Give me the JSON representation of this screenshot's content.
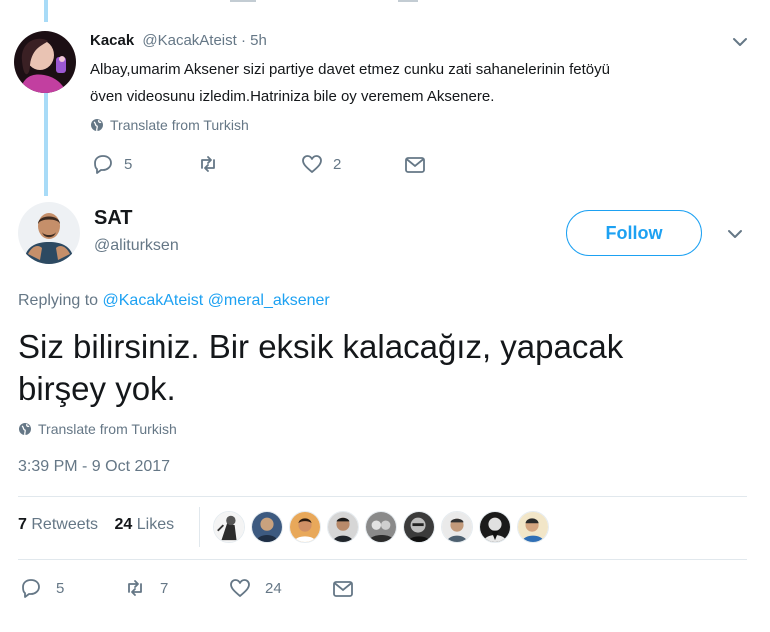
{
  "reply": {
    "name": "Kacak",
    "handle": "@KacakAteist",
    "time": "· 5h",
    "text_line1": "Albay,umarim Aksener sizi partiye davet etmez cunku zati sahanelerinin fetöyü",
    "text_line2": "öven videosunu izledim.Hatriniza bile oy veremem Aksenere.",
    "translate_label": "Translate from Turkish",
    "reply_count": "5",
    "like_count": "2"
  },
  "tweet": {
    "name": "SAT",
    "handle": "@aliturksen",
    "follow_label": "Follow",
    "replying_prefix": "Replying to",
    "replying_to_1": "@KacakAteist",
    "replying_to_2": "@meral_aksener",
    "text_line1": "Siz bilirsiniz. Bir eksik kalacağız, yapacak",
    "text_line2": "birşey yok.",
    "translate_label": "Translate from Turkish",
    "timestamp": "3:39 PM - 9 Oct 2017",
    "retweets_count": "7",
    "retweets_label": "Retweets",
    "likes_count": "24",
    "likes_label": "Likes",
    "actions": {
      "reply_count": "5",
      "retweet_count": "7",
      "like_count": "24"
    }
  },
  "colors": {
    "accent": "#1da1f2",
    "muted": "#657786",
    "thread_line": "#a8dbf7",
    "divider": "#e1e8ed"
  },
  "icons": [
    "reply-icon",
    "retweet-icon",
    "like-icon",
    "message-icon",
    "globe-icon",
    "chevron-down-icon"
  ]
}
